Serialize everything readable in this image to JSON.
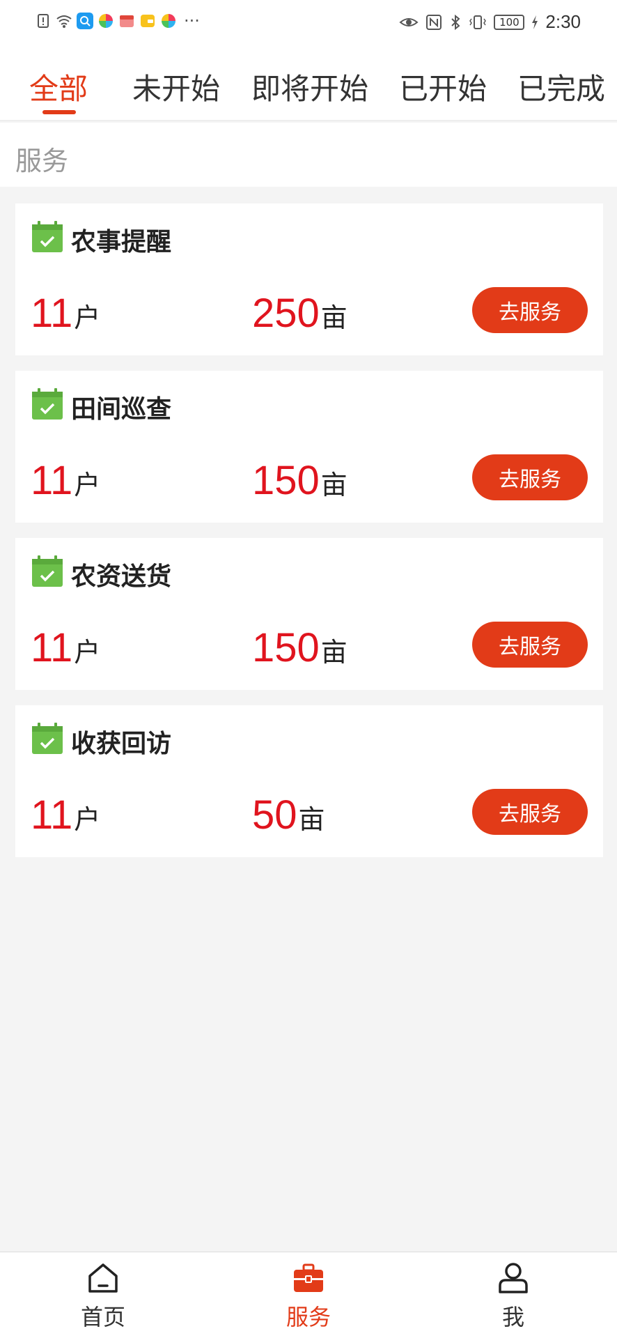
{
  "status_bar": {
    "time": "2:30",
    "battery": "100"
  },
  "tabs": [
    {
      "label": "全部",
      "active": true
    },
    {
      "label": "未开始",
      "active": false
    },
    {
      "label": "即将开始",
      "active": false
    },
    {
      "label": "已开始",
      "active": false
    },
    {
      "label": "已完成",
      "active": false
    }
  ],
  "section": {
    "title": "服务"
  },
  "cards": [
    {
      "title": "农事提醒",
      "households": "11",
      "households_unit": "户",
      "area": "250",
      "area_unit": "亩",
      "button": "去服务"
    },
    {
      "title": "田间巡查",
      "households": "11",
      "households_unit": "户",
      "area": "150",
      "area_unit": "亩",
      "button": "去服务"
    },
    {
      "title": "农资送货",
      "households": "11",
      "households_unit": "户",
      "area": "150",
      "area_unit": "亩",
      "button": "去服务"
    },
    {
      "title": "收获回访",
      "households": "11",
      "households_unit": "户",
      "area": "50",
      "area_unit": "亩",
      "button": "去服务"
    }
  ],
  "bottom_nav": [
    {
      "label": "首页",
      "icon": "home-icon",
      "active": false
    },
    {
      "label": "服务",
      "icon": "toolbox-icon",
      "active": true
    },
    {
      "label": "我",
      "icon": "user-icon",
      "active": false
    }
  ],
  "colors": {
    "accent": "#e23b18",
    "number_red": "#e0141e",
    "calendar_green": "#6cc04a"
  }
}
